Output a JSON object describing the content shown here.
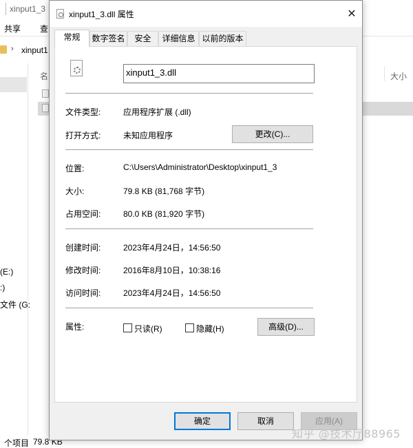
{
  "background": {
    "window_title": "xinput1_3",
    "ribbon_tabs": [
      "共享",
      "查"
    ],
    "address_text": "xinput1",
    "column_name": "名",
    "column_size": "大小",
    "drive_e": "(E:)",
    "drive_2": ":)",
    "drive_3": "文件 (G:",
    "status_count": "个项目",
    "status_size": "79.8 KB"
  },
  "dialog": {
    "title": "xinput1_3.dll 属性",
    "close_glyph": "✕",
    "tabs": [
      {
        "label": "常规",
        "active": true
      },
      {
        "label": "数字签名",
        "active": false
      },
      {
        "label": "安全",
        "active": false
      },
      {
        "label": "详细信息",
        "active": false
      },
      {
        "label": "以前的版本",
        "active": false
      }
    ],
    "file_icon": "dll-gear-icon",
    "file_name": "xinput1_3.dll",
    "file_type": {
      "label": "文件类型:",
      "value": "应用程序扩展 (.dll)"
    },
    "opens_with": {
      "label": "打开方式:",
      "value": "未知应用程序",
      "button": "更改(C)..."
    },
    "location": {
      "label": "位置:",
      "value": "C:\\Users\\Administrator\\Desktop\\xinput1_3"
    },
    "size": {
      "label": "大小:",
      "value": "79.8 KB (81,768 字节)"
    },
    "size_on_disk": {
      "label": "占用空间:",
      "value": "80.0 KB (81,920 字节)"
    },
    "created": {
      "label": "创建时间:",
      "value": "2023年4月24日，14:56:50"
    },
    "modified": {
      "label": "修改时间:",
      "value": "2016年8月10日，10:38:16"
    },
    "accessed": {
      "label": "访问时间:",
      "value": "2023年4月24日，14:56:50"
    },
    "attributes": {
      "label": "属性:",
      "readonly": {
        "label": "只读(R)",
        "checked": false
      },
      "hidden": {
        "label": "隐藏(H)",
        "checked": false
      },
      "advanced_button": "高级(D)..."
    },
    "buttons": {
      "ok": "确定",
      "cancel": "取消",
      "apply": "应用(A)"
    }
  },
  "watermark": "知乎 @技术厅88965",
  "colors": {
    "accent": "#0078d7",
    "dialog_bg": "#f0f0f0",
    "button_bg": "#e1e1e1"
  }
}
